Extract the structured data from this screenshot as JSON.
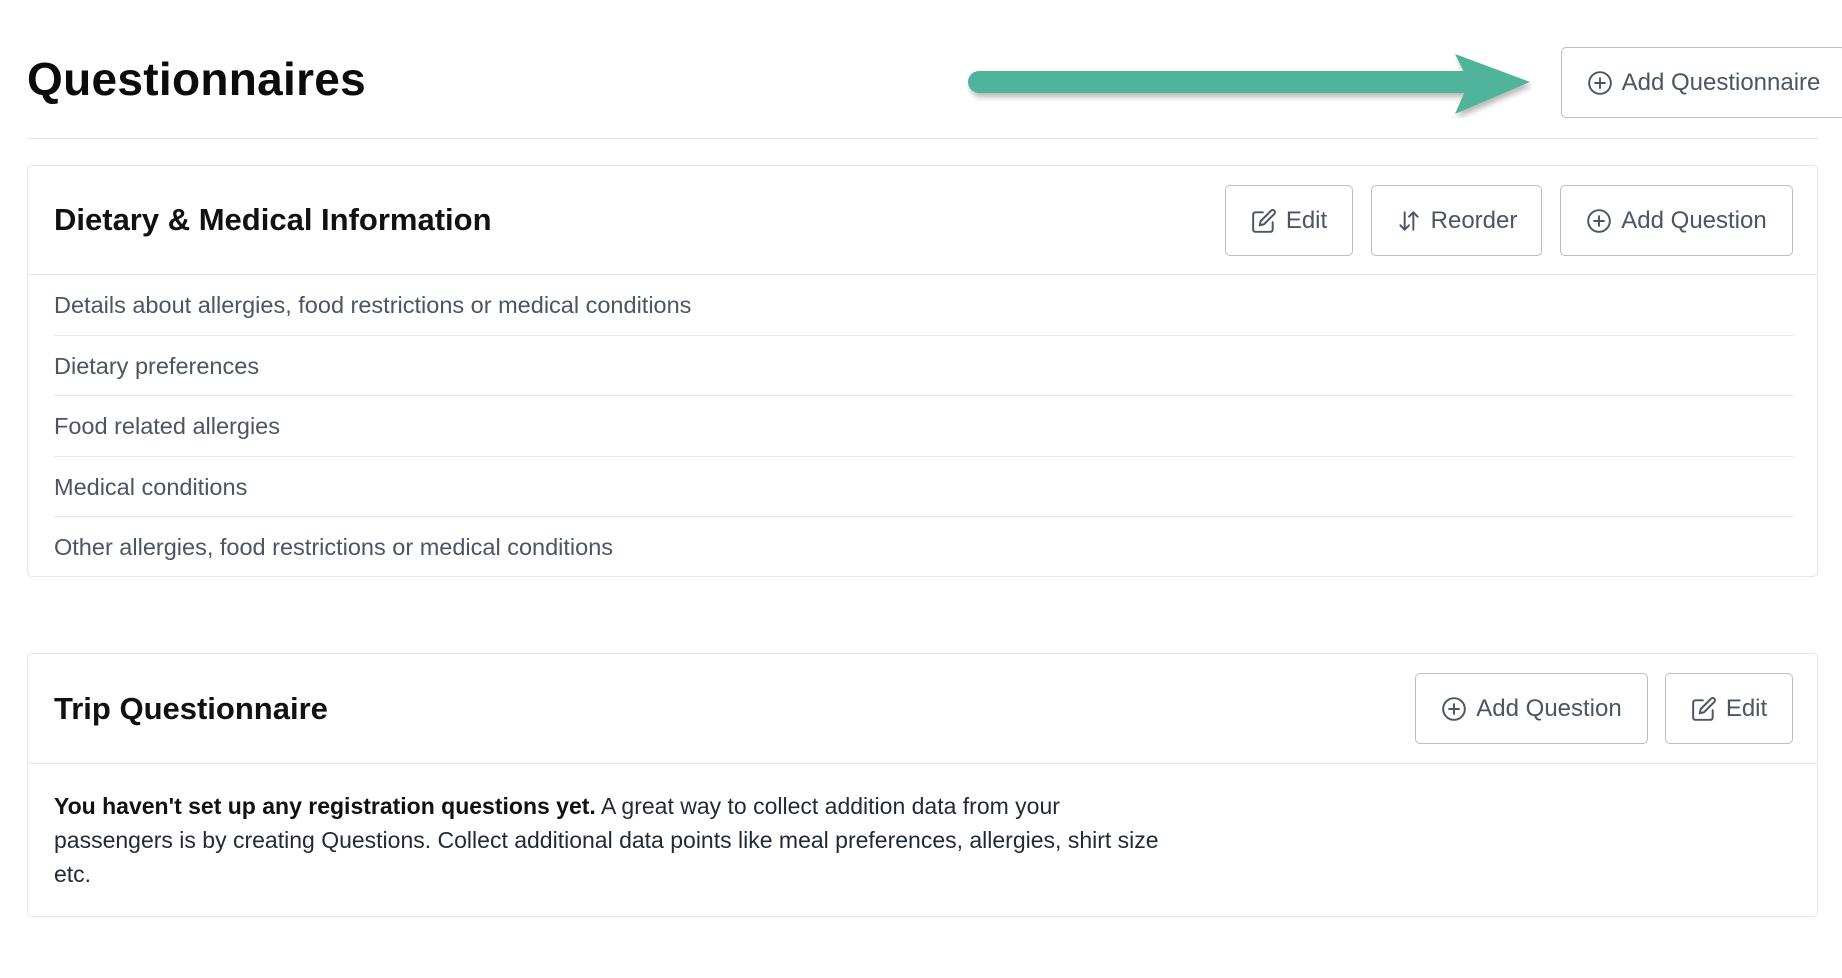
{
  "page": {
    "title": "Questionnaires",
    "add_questionnaire_label": "Add Questionnaire",
    "arrow_color": "#4fb49a"
  },
  "questionnaires": [
    {
      "title": "Dietary & Medical Information",
      "actions": {
        "edit_label": "Edit",
        "reorder_label": "Reorder",
        "add_question_label": "Add Question"
      },
      "questions": [
        "Details about allergies, food restrictions or medical conditions",
        "Dietary preferences",
        "Food related allergies",
        "Medical conditions",
        "Other allergies, food restrictions or medical conditions"
      ]
    },
    {
      "title": "Trip Questionnaire",
      "actions": {
        "add_question_label": "Add Question",
        "edit_label": "Edit"
      },
      "empty_state": {
        "bold": "You haven't set up any registration questions yet.",
        "text": " A great way to collect addition data from your passengers is by creating Questions. Collect additional data points like meal preferences, allergies, shirt size etc."
      }
    }
  ],
  "icons": {
    "add": "plus-circle-icon",
    "edit": "edit-icon",
    "reorder": "sort-arrows-icon"
  }
}
